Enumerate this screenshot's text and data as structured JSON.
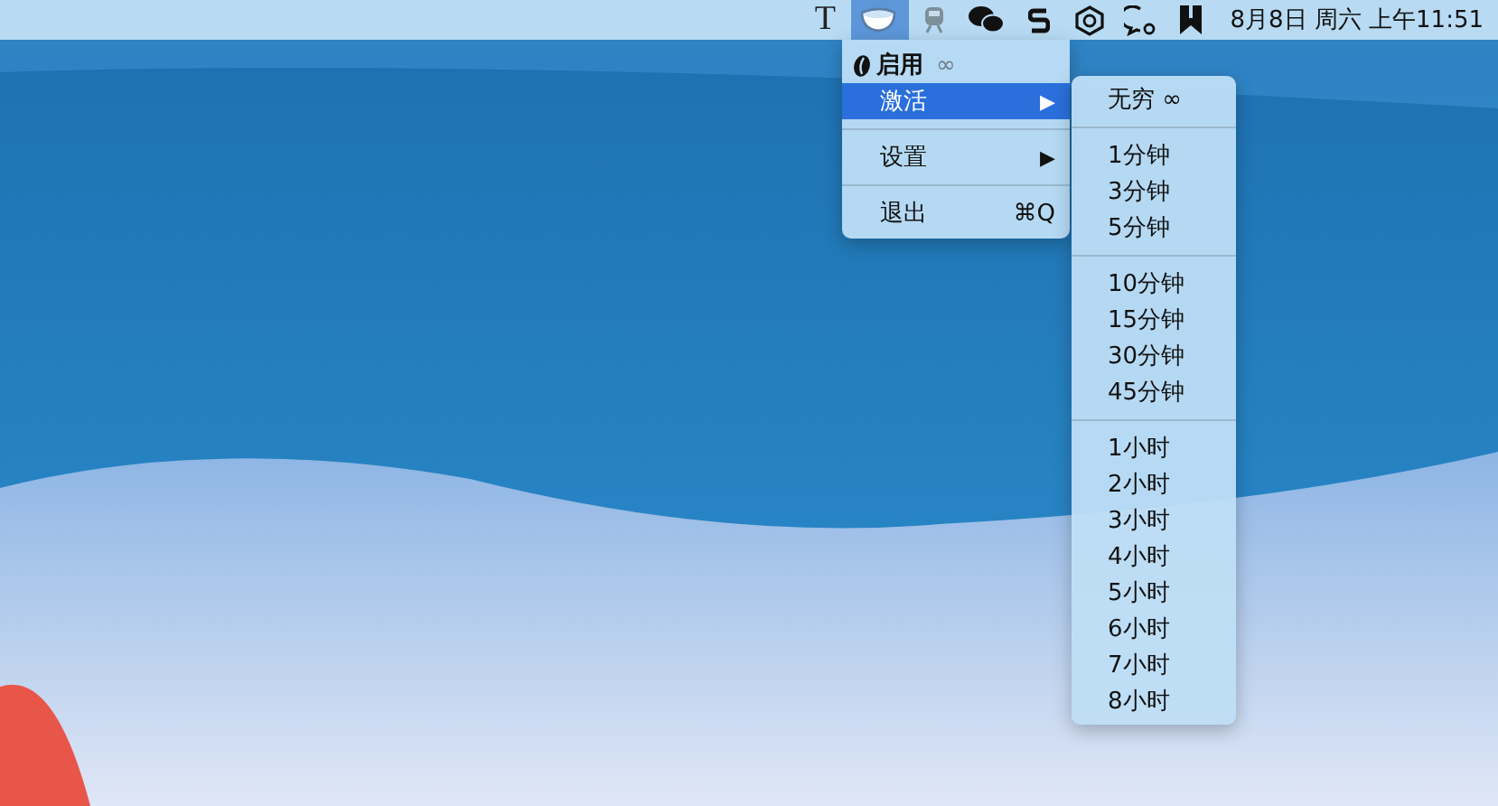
{
  "menu_bar": {
    "items": [
      {
        "kind": "text-glyph",
        "text": "T",
        "selected": false
      },
      {
        "kind": "cup",
        "selected": true
      },
      {
        "kind": "train",
        "selected": false
      },
      {
        "kind": "chat-bubbles",
        "selected": false
      },
      {
        "kind": "s-glyph",
        "selected": false
      },
      {
        "kind": "hexagon",
        "selected": false
      },
      {
        "kind": "chat-gear",
        "selected": false
      },
      {
        "kind": "bookmark",
        "selected": false
      }
    ],
    "clock": "8月8日 周六 上午11:51"
  },
  "menu": {
    "items": [
      {
        "kind": "header",
        "label": "启用",
        "suffix": "∞"
      },
      {
        "kind": "item",
        "label": "激活",
        "arrow": "▶",
        "selected": true
      },
      {
        "kind": "separator"
      },
      {
        "kind": "item",
        "label": "设置",
        "arrow": "▶",
        "selected": false
      },
      {
        "kind": "separator"
      },
      {
        "kind": "item",
        "label": "退出",
        "shortcut": "⌘Q",
        "selected": false
      }
    ]
  },
  "submenu": {
    "items": [
      {
        "kind": "item",
        "label": "无穷 ∞"
      },
      {
        "kind": "separator"
      },
      {
        "kind": "item",
        "label": "1分钟"
      },
      {
        "kind": "item",
        "label": "3分钟"
      },
      {
        "kind": "item",
        "label": "5分钟"
      },
      {
        "kind": "separator"
      },
      {
        "kind": "item",
        "label": "10分钟"
      },
      {
        "kind": "item",
        "label": "15分钟"
      },
      {
        "kind": "item",
        "label": "30分钟"
      },
      {
        "kind": "item",
        "label": "45分钟"
      },
      {
        "kind": "separator"
      },
      {
        "kind": "item",
        "label": "1小时"
      },
      {
        "kind": "item",
        "label": "2小时"
      },
      {
        "kind": "item",
        "label": "3小时"
      },
      {
        "kind": "item",
        "label": "4小时"
      },
      {
        "kind": "item",
        "label": "5小时"
      },
      {
        "kind": "item",
        "label": "6小时"
      },
      {
        "kind": "item",
        "label": "7小时"
      },
      {
        "kind": "item",
        "label": "8小时"
      }
    ]
  }
}
